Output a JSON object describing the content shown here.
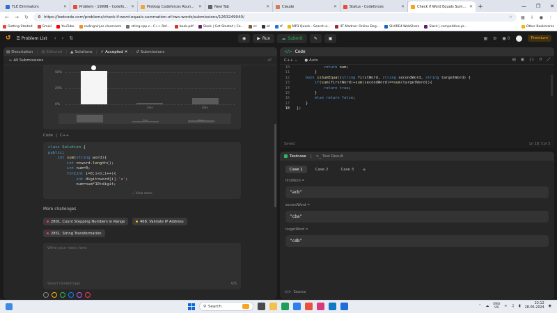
{
  "browser": {
    "tabs": [
      {
        "title": "TLE Eliminators",
        "color": "#2d6fd6",
        "active": false
      },
      {
        "title": "Problem - 1999B - Codeforces",
        "color": "#e94b35",
        "active": false
      },
      {
        "title": "Pinkkop Codeforces Round 90/",
        "color": "#f2a33a",
        "active": false
      },
      {
        "title": "New Tab",
        "color": "#5f6368",
        "active": false
      },
      {
        "title": "Claude",
        "color": "#d97757",
        "active": false
      },
      {
        "title": "Status - Codeforces",
        "color": "#e94b35",
        "active": false
      },
      {
        "title": "Check if Word Equals Summati",
        "color": "#ffa116",
        "active": true
      }
    ],
    "url": "https://leetcode.com/problems/check-if-word-equals-summation-of-two-words/submissions/1263249040/",
    "bookmarks": [
      {
        "label": "Getting Started",
        "color": "#ea4335"
      },
      {
        "label": "Gmail",
        "color": "#ea4335"
      },
      {
        "label": "YouTube",
        "color": "#ff0000"
      },
      {
        "label": "codingninjas classroom",
        "color": "#f28b22"
      },
      {
        "label": "string.cpp.c - C++ Ref...",
        "color": "#6d6d6d"
      },
      {
        "label": "book.pdf",
        "color": "#d93025"
      },
      {
        "label": "Slack | Get Started | Co...",
        "color": "#611f69"
      },
      {
        "label": "cc",
        "color": "#7b5b3b"
      },
      {
        "label": "at",
        "color": "#333333"
      },
      {
        "label": "cf",
        "color": "#1a73e8"
      },
      {
        "label": "MP3 Quack - Search a...",
        "color": "#f4b400"
      },
      {
        "label": "IIT Madras: Online Deg...",
        "color": "#9c2a2a"
      },
      {
        "label": "SHARE4-WebShare",
        "color": "#1565c0"
      },
      {
        "label": "Slack | competitive-pr...",
        "color": "#611f69"
      }
    ],
    "other_bookmarks": "Other Bookmarks"
  },
  "nav": {
    "problem_list": "Problem List",
    "run": "Run",
    "submit": "Submit",
    "notif_count": "0",
    "premium": "Premium"
  },
  "left": {
    "tabs": {
      "description": "Description",
      "editorial": "Editorial",
      "solutions": "Solutions",
      "accepted": "Accepted",
      "submissions": "Submissions"
    },
    "all_submissions": "All Submissions",
    "chart": {
      "y_ticks": [
        "50%",
        "25%",
        "0%"
      ],
      "x_labels": [
        "1ms",
        "2ms"
      ],
      "scrub_labels": [
        "0ms",
        "2ms"
      ]
    },
    "code_header": {
      "label": "Code",
      "lang": "C++"
    },
    "code_lines": [
      [
        "kw:class ",
        "ty:Solution ",
        "t:{"
      ],
      [
        "kw:public",
        "t::"
      ],
      [
        "t:    ",
        "kw:int ",
        "fn:sum",
        "t:(",
        "kw:string ",
        "t:word){"
      ],
      [
        "t:        ",
        "kw:int ",
        "t:n=word.",
        "fn:length",
        "t:();"
      ],
      [
        "t:        ",
        "kw:int ",
        "t:num=0;"
      ],
      [
        "t:        ",
        "kw:for",
        "t:(",
        "kw:int ",
        "t:i=0;i<n;i++){"
      ],
      [
        "t:            ",
        "kw:int ",
        "t:digit=word[i]-",
        "st:'a'",
        "t:;"
      ],
      [
        "t:            ",
        "t:num=num*10+digit;"
      ]
    ],
    "view_more": "View more",
    "more_challenges": "More challenges",
    "challenges": [
      {
        "label": "2801. Count Stepping Numbers in Range",
        "dot": "#ff375f"
      },
      {
        "label": "468. Validate IP Address",
        "dot": "#ffb800"
      },
      {
        "label": "2851. String Transformation",
        "dot": "#ff375f"
      }
    ],
    "notes_placeholder": "Write your notes here",
    "notes_tags": "Select related tags",
    "notes_count": "0/5",
    "color_dots": [
      "#8a8a8a",
      "#ffb800",
      "#2cbb5d",
      "#0a84ff",
      "#bf5af2",
      "#ff375f"
    ]
  },
  "editor": {
    "title": "Code",
    "lang": "C++",
    "mode": "Auto",
    "lines": [
      {
        "n": "10",
        "code": [
          [
            "t:            "
          ],
          [
            "kw:return "
          ],
          [
            "t:num;"
          ]
        ]
      },
      {
        "n": "11",
        "code": [
          [
            "t:        }"
          ]
        ]
      },
      {
        "n": "12",
        "code": [
          [
            "t:    "
          ],
          [
            "kw:bool "
          ],
          [
            "fn:isSumEqual"
          ],
          [
            "t:("
          ],
          [
            "kw:string "
          ],
          [
            "t:firstWord, "
          ],
          [
            "kw:string "
          ],
          [
            "t:secondWord, "
          ],
          [
            "kw:string "
          ],
          [
            "t:targetWord) {"
          ]
        ]
      },
      {
        "n": "13",
        "code": [
          [
            "t:        "
          ],
          [
            "kw:if"
          ],
          [
            "t:("
          ],
          [
            "fn:sum"
          ],
          [
            "t:(firstWord)+"
          ],
          [
            "fn:sum"
          ],
          [
            "t:(secondWord)=="
          ],
          [
            "fn:sum"
          ],
          [
            "t:(targetWord)){"
          ]
        ]
      },
      {
        "n": "14",
        "code": [
          [
            "t:            "
          ],
          [
            "kw:return "
          ],
          [
            "kw:true"
          ],
          [
            "t:;"
          ]
        ]
      },
      {
        "n": "15",
        "code": [
          [
            "t:        }"
          ]
        ]
      },
      {
        "n": "16",
        "code": [
          [
            "t:        "
          ],
          [
            "kw:else "
          ],
          [
            "kw:return "
          ],
          [
            "kw:false"
          ],
          [
            "t:;"
          ]
        ]
      },
      {
        "n": "17",
        "code": [
          [
            "t:    }"
          ]
        ]
      },
      {
        "n": "18",
        "code": [
          [
            "t:};"
          ]
        ]
      }
    ],
    "saved": "Saved",
    "cursor": "Ln 18, Col 3"
  },
  "testcase": {
    "tab_testcase": "Testcase",
    "tab_result": "Test Result",
    "cases": [
      "Case 1",
      "Case 2",
      "Case 3"
    ],
    "fields": [
      {
        "label": "firstWord =",
        "value": "\"acb\""
      },
      {
        "label": "secondWord =",
        "value": "\"cba\""
      },
      {
        "label": "targetWord =",
        "value": "\"cdb\""
      }
    ],
    "source": "Source"
  },
  "taskbar": {
    "search": "Search",
    "lang_top": "ENG",
    "lang_bottom": "US",
    "time": "22:12",
    "date": "28-05-2024"
  }
}
